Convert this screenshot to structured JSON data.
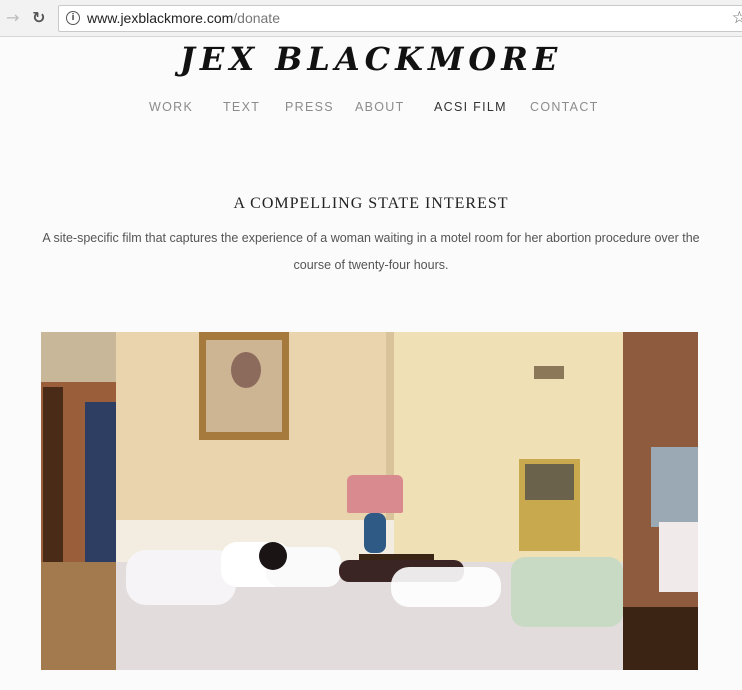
{
  "browser": {
    "url_host": "www.jexblackmore.com",
    "url_path": "/donate",
    "back_icon": "arrow-left-icon",
    "reload_icon": "reload-icon",
    "info_icon": "info-icon",
    "bookmark_icon": "star-icon"
  },
  "site": {
    "logo": "JEX BLACKMORE",
    "nav": [
      {
        "label": "WORK"
      },
      {
        "label": "TEXT"
      },
      {
        "label": "PRESS"
      },
      {
        "label": "ABOUT"
      },
      {
        "label": "ACSI FILM",
        "active": true
      },
      {
        "label": "CONTACT"
      }
    ]
  },
  "content": {
    "title": "A COMPELLING STATE INTEREST",
    "description": "A site-specific film that captures the experience of a woman waiting in a motel room for her abortion procedure over the course of twenty-four hours."
  },
  "colors": {
    "page_bg": "#fbfbfb",
    "nav_text": "#8c8c8c",
    "nav_active": "#333333"
  }
}
